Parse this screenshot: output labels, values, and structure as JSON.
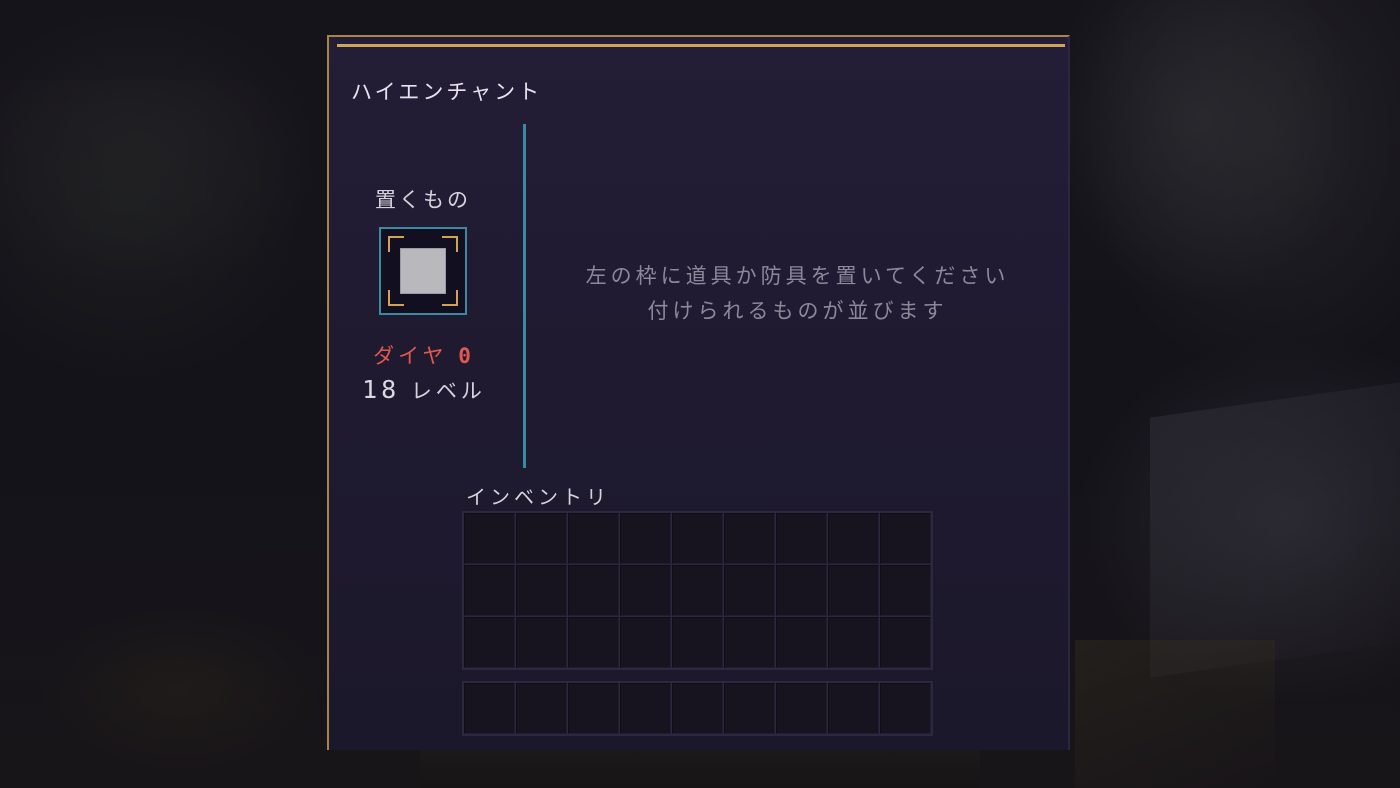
{
  "window": {
    "title": "ハイエンチャント"
  },
  "item_slot": {
    "label": "置くもの",
    "icon": "empty-item-slot-icon"
  },
  "cost": {
    "diamond_label": "ダイヤ",
    "diamond_count": "0",
    "level_number": "18",
    "level_label": "レベル"
  },
  "hint": {
    "line1": "左の枠に道具か防具を置いてください",
    "line2": "付けられるものが並びます"
  },
  "inventory": {
    "label": "インベントリ",
    "rows": 3,
    "columns": 9,
    "hotbar_columns": 9
  },
  "colors": {
    "panel_border_gold": "#cfa55e",
    "divider_teal": "#3a8aa0",
    "diamond_red": "#e0584e",
    "panel_background": "#201a32",
    "hint_text": "#8c8799"
  }
}
